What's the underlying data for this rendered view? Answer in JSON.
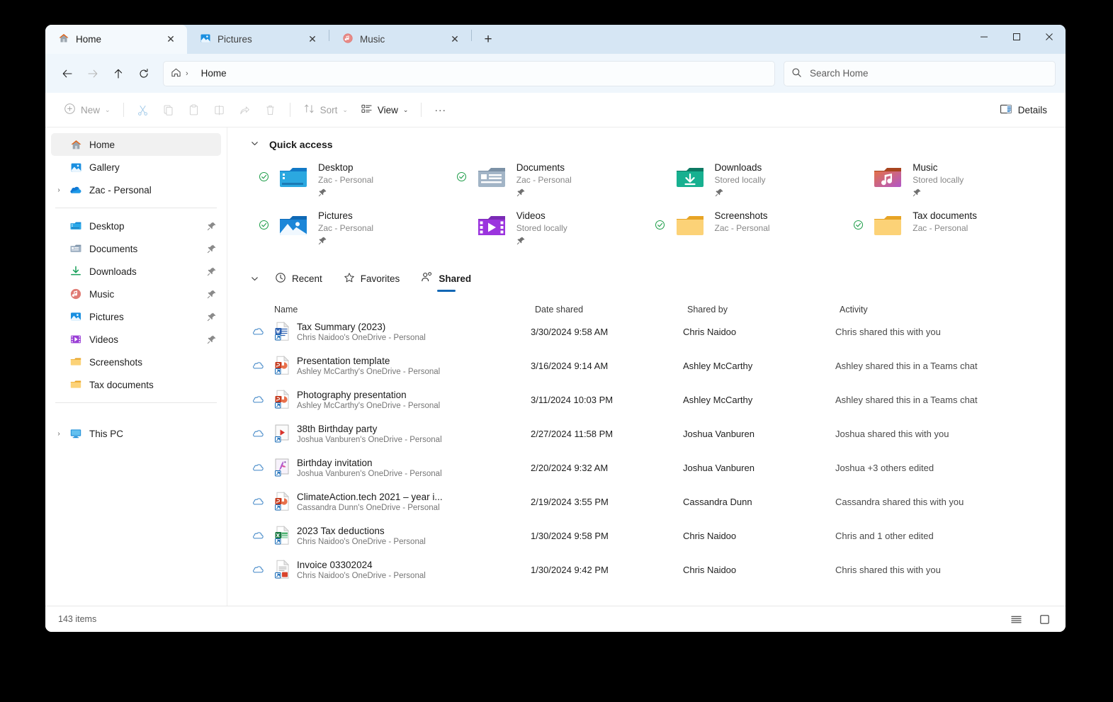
{
  "window": {
    "tabs": [
      {
        "label": "Home",
        "icon": "home-icon",
        "active": true,
        "close": "✕"
      },
      {
        "label": "Pictures",
        "icon": "pictures-icon",
        "active": false,
        "close": "✕"
      },
      {
        "label": "Music",
        "icon": "music-icon",
        "active": false,
        "close": "✕"
      }
    ],
    "new_tab_label": "+",
    "controls": {
      "minimize": "–",
      "maximize": "☐",
      "close": "✕"
    }
  },
  "addressbar": {
    "back": "←",
    "forward": "→",
    "up": "↑",
    "refresh": "↻",
    "crumb_chevron": "›",
    "crumb_text": "Home",
    "search_placeholder": "Search Home"
  },
  "toolbar": {
    "new_label": "New",
    "sort_label": "Sort",
    "view_label": "View",
    "more_label": "···",
    "chevron": "⌄",
    "details_label": "Details",
    "items": [
      {
        "name": "cut-icon"
      },
      {
        "name": "copy-icon"
      },
      {
        "name": "paste-icon"
      },
      {
        "name": "rename-icon"
      },
      {
        "name": "share-icon"
      },
      {
        "name": "delete-icon"
      }
    ]
  },
  "sidebar": {
    "top": [
      {
        "label": "Home",
        "icon": "home-icon",
        "selected": true,
        "expandable": false,
        "pinned": false
      },
      {
        "label": "Gallery",
        "icon": "gallery-icon",
        "selected": false,
        "expandable": false,
        "pinned": false
      },
      {
        "label": "Zac - Personal",
        "icon": "onedrive-icon",
        "selected": false,
        "expandable": true,
        "pinned": false
      }
    ],
    "folders": [
      {
        "label": "Desktop",
        "icon": "desktop-folder-icon",
        "pinned": true
      },
      {
        "label": "Documents",
        "icon": "documents-folder-icon",
        "pinned": true
      },
      {
        "label": "Downloads",
        "icon": "downloads-icon",
        "pinned": true
      },
      {
        "label": "Music",
        "icon": "music-folder-icon",
        "pinned": true
      },
      {
        "label": "Pictures",
        "icon": "pictures-folder-icon",
        "pinned": true
      },
      {
        "label": "Videos",
        "icon": "videos-folder-icon",
        "pinned": true
      },
      {
        "label": "Screenshots",
        "icon": "folder-icon",
        "pinned": false
      },
      {
        "label": "Tax documents",
        "icon": "folder-icon",
        "pinned": false
      }
    ],
    "bottom": [
      {
        "label": "This PC",
        "icon": "this-pc-icon",
        "expandable": true
      }
    ],
    "expand_chevron": "›",
    "pin_glyph": "📌"
  },
  "quick_access": {
    "title": "Quick access",
    "chevron": "⌄",
    "items": [
      {
        "name": "Desktop",
        "sub": "Zac - Personal",
        "icon": "desktop-folder-icon",
        "synced": true,
        "pinned": true
      },
      {
        "name": "Documents",
        "sub": "Zac - Personal",
        "icon": "documents-folder-icon",
        "synced": true,
        "pinned": true
      },
      {
        "name": "Downloads",
        "sub": "Stored locally",
        "icon": "downloads-icon",
        "synced": false,
        "pinned": true
      },
      {
        "name": "Music",
        "sub": "Stored locally",
        "icon": "music-folder-icon",
        "synced": false,
        "pinned": true
      },
      {
        "name": "Pictures",
        "sub": "Zac - Personal",
        "icon": "pictures-folder-icon",
        "synced": true,
        "pinned": true
      },
      {
        "name": "Videos",
        "sub": "Stored locally",
        "icon": "videos-folder-icon",
        "synced": false,
        "pinned": true
      },
      {
        "name": "Screenshots",
        "sub": "Zac - Personal",
        "icon": "folder-icon",
        "synced": true,
        "pinned": false
      },
      {
        "name": "Tax documents",
        "sub": "Zac - Personal",
        "icon": "folder-icon",
        "synced": true,
        "pinned": false
      }
    ]
  },
  "file_tabs": {
    "chevron": "⌄",
    "items": [
      {
        "label": "Recent",
        "icon": "clock-icon",
        "active": false
      },
      {
        "label": "Favorites",
        "icon": "star-icon",
        "active": false
      },
      {
        "label": "Shared",
        "icon": "people-icon",
        "active": true
      }
    ]
  },
  "table": {
    "columns": [
      "Name",
      "Date shared",
      "Shared by",
      "Activity"
    ],
    "rows": [
      {
        "title": "Tax Summary (2023)",
        "sub": "Chris Naidoo's OneDrive - Personal",
        "icon": "word-file-icon",
        "date": "3/30/2024 9:58 AM",
        "by": "Chris Naidoo",
        "activity": "Chris shared this with you"
      },
      {
        "title": "Presentation template",
        "sub": "Ashley McCarthy's OneDrive - Personal",
        "icon": "powerpoint-file-icon",
        "date": "3/16/2024 9:14 AM",
        "by": "Ashley McCarthy",
        "activity": "Ashley shared this in a Teams chat"
      },
      {
        "title": "Photography presentation",
        "sub": "Ashley McCarthy's OneDrive - Personal",
        "icon": "powerpoint-file-icon",
        "date": "3/11/2024 10:03 PM",
        "by": "Ashley McCarthy",
        "activity": "Ashley shared this in a Teams chat"
      },
      {
        "title": "38th Birthday party",
        "sub": "Joshua Vanburen's OneDrive - Personal",
        "icon": "video-file-icon",
        "date": "2/27/2024 11:58 PM",
        "by": "Joshua Vanburen",
        "activity": "Joshua shared this with you"
      },
      {
        "title": "Birthday invitation",
        "sub": "Joshua Vanburen's OneDrive - Personal",
        "icon": "image-file-icon",
        "date": "2/20/2024 9:32 AM",
        "by": "Joshua Vanburen",
        "activity": "Joshua +3 others edited"
      },
      {
        "title": "ClimateAction.tech 2021 – year i...",
        "sub": "Cassandra Dunn's OneDrive - Personal",
        "icon": "powerpoint-file-icon",
        "date": "2/19/2024 3:55 PM",
        "by": "Cassandra Dunn",
        "activity": "Cassandra shared this with you"
      },
      {
        "title": "2023 Tax deductions",
        "sub": "Chris Naidoo's OneDrive - Personal",
        "icon": "excel-file-icon",
        "date": "1/30/2024 9:58 PM",
        "by": "Chris Naidoo",
        "activity": "Chris and 1 other edited"
      },
      {
        "title": "Invoice 03302024",
        "sub": "Chris Naidoo's OneDrive - Personal",
        "icon": "pdf-file-icon",
        "date": "1/30/2024 9:42 PM",
        "by": "Chris Naidoo",
        "activity": "Chris shared this with you"
      }
    ]
  },
  "statusbar": {
    "item_count": "143 items",
    "views": [
      {
        "name": "details-view-icon"
      },
      {
        "name": "tiles-view-icon"
      }
    ]
  },
  "colors": {
    "accent": "#1267b5",
    "tabstrip": "#d6e6f4",
    "addressbar": "#eff6fc",
    "sync_green": "#1f9e4a"
  }
}
